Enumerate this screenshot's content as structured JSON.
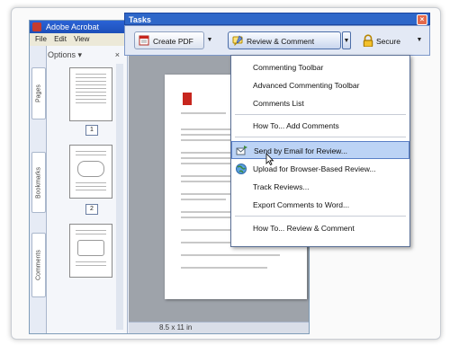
{
  "acrobat": {
    "title": "Adobe Acrobat",
    "menu": [
      "File",
      "Edit",
      "View"
    ],
    "nav_options": "Options",
    "nav_tabs": [
      "Pages",
      "Bookmarks",
      "Comments"
    ],
    "thumb_labels": [
      "1",
      "2"
    ],
    "page_size": "8.5 x 11 in"
  },
  "tasks": {
    "title": "Tasks",
    "create_pdf": "Create PDF",
    "review_comment": "Review & Comment",
    "secure": "Secure"
  },
  "menu": {
    "items": [
      "Commenting Toolbar",
      "Advanced Commenting Toolbar",
      "Comments List",
      "How To... Add Comments",
      "Send by Email for Review...",
      "Upload for Browser-Based Review...",
      "Track Reviews...",
      "Export Comments to Word...",
      "How To... Review & Comment"
    ],
    "highlighted_index": 4
  },
  "colors": {
    "tasks_title_bg": "#2e67c9",
    "menu_highlight": "#bcd3f5",
    "acrobat_red": "#c7261e"
  }
}
